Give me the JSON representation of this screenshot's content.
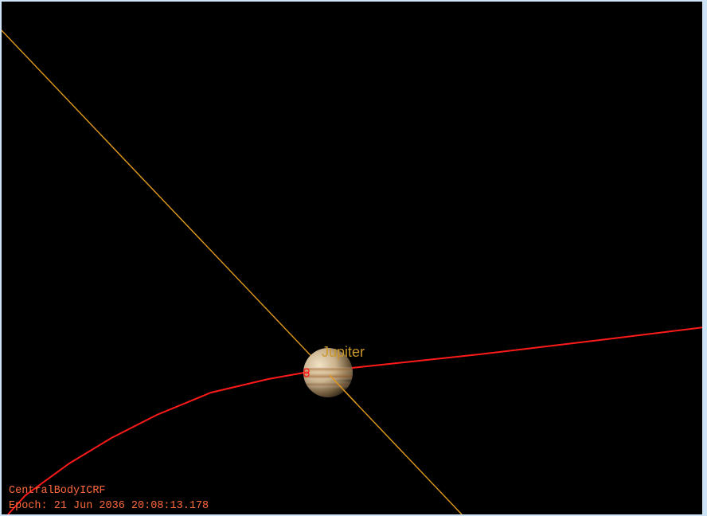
{
  "scene": {
    "background_color": "#000000",
    "central_body": {
      "label": "Jupiter",
      "label_color": "#c8962a"
    },
    "lines": {
      "axis_line_color": "#e09a1c",
      "trajectory_color": "#ff1a1a"
    }
  },
  "overlay": {
    "reference_frame": "CentralBodyICRF",
    "epoch": "Epoch: 21 Jun 2036 20:08:13.178",
    "text_color": "#ff6a3d"
  }
}
